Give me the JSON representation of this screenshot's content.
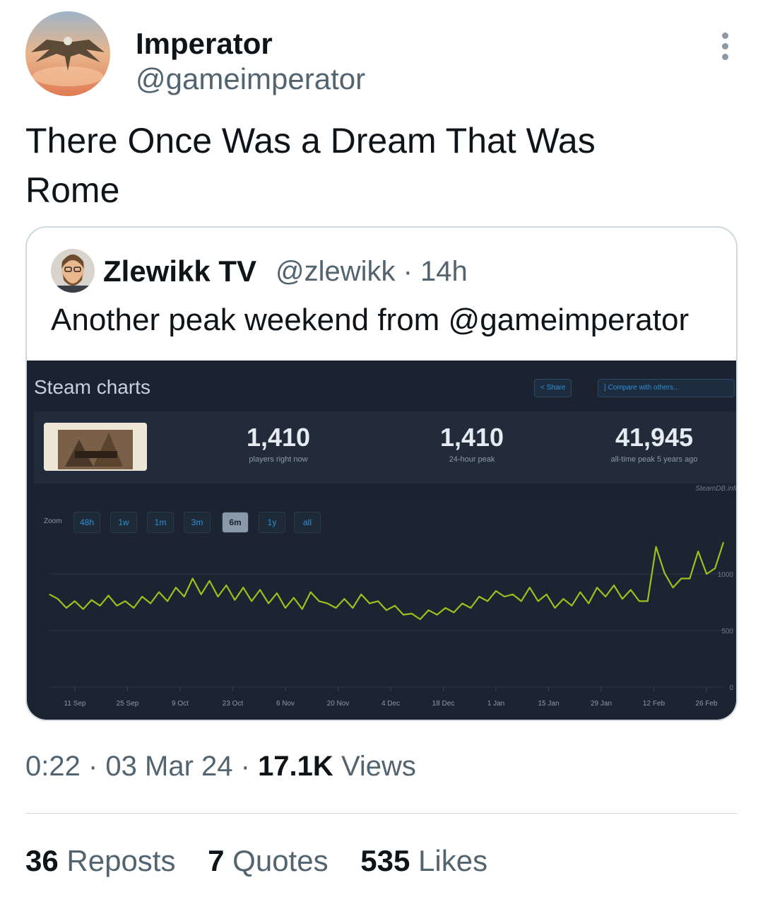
{
  "author": {
    "name": "Imperator",
    "handle": "@gameimperator"
  },
  "tweet": {
    "text": "There Once Was a Dream That Was Rome"
  },
  "quoted": {
    "name": "Zlewikk TV",
    "meta": "@zlewikk · 14h",
    "text": "Another peak weekend from @gameimperator",
    "image": {
      "title": "Steam charts",
      "share_label": "Share",
      "compare_label": "Compare with others...",
      "stats": [
        {
          "value": "1,410",
          "label": "players right now"
        },
        {
          "value": "1,410",
          "label": "24-hour peak"
        },
        {
          "value": "41,945",
          "label": "all-time peak 5 years ago"
        }
      ],
      "credit": "SteamDB.info",
      "zoom_label": "Zoom",
      "zoom_options": [
        "48h",
        "1w",
        "1m",
        "3m",
        "6m",
        "1y",
        "all"
      ],
      "zoom_selected": "6m"
    }
  },
  "chart_data": {
    "type": "line",
    "series": [
      {
        "values": [
          820,
          780,
          700,
          760,
          690,
          770,
          720,
          810,
          720,
          760,
          700,
          800,
          740,
          840,
          760,
          880,
          800,
          960,
          820,
          940,
          800,
          900,
          770,
          880,
          760,
          860,
          740,
          830,
          700,
          790,
          690,
          840,
          760,
          740,
          700,
          780,
          700,
          820,
          740,
          760,
          680,
          720,
          640,
          650,
          600,
          680,
          640,
          700,
          660,
          740,
          700,
          800,
          760,
          850,
          800,
          820,
          760,
          880,
          760,
          820,
          700,
          780,
          720,
          840,
          740,
          880,
          800,
          900,
          780,
          860,
          760,
          760,
          1240,
          1010,
          880,
          960,
          960,
          1200,
          1000,
          1050,
          1280
        ]
      }
    ],
    "x_ticks": [
      "11 Sep",
      "25 Sep",
      "9 Oct",
      "23 Oct",
      "6 Nov",
      "20 Nov",
      "4 Dec",
      "18 Dec",
      "1 Jan",
      "15 Jan",
      "29 Jan",
      "12 Feb",
      "26 Feb"
    ],
    "y_ticks": [
      "0",
      "500",
      "1000"
    ],
    "ylim": [
      0,
      1300
    ],
    "grid": true,
    "color": "#9ac21f"
  },
  "footer": {
    "time": "0:22",
    "date": "03 Mar 24",
    "views_count": "17.1K",
    "views_label": "Views"
  },
  "engagement": {
    "reposts": {
      "count": "36",
      "label": "Reposts"
    },
    "quotes": {
      "count": "7",
      "label": "Quotes"
    },
    "likes": {
      "count": "535",
      "label": "Likes"
    }
  }
}
